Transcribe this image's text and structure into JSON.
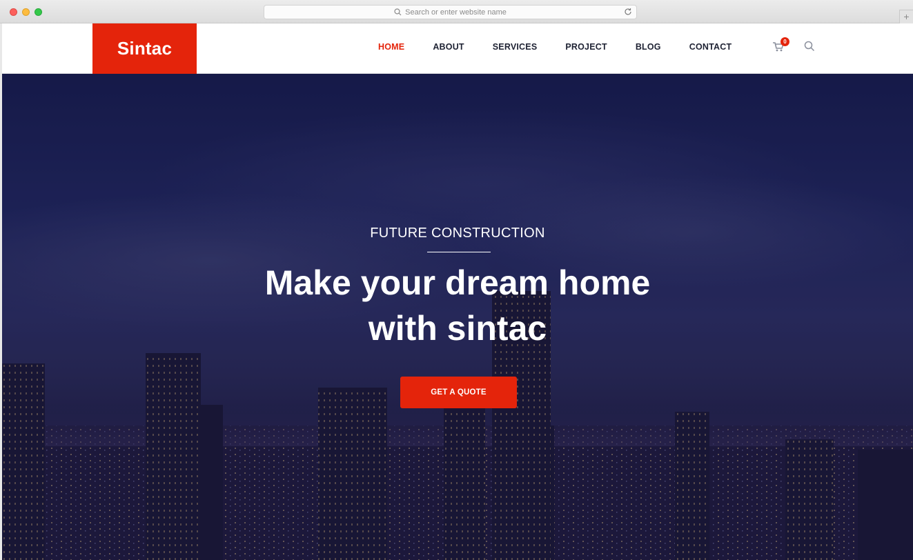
{
  "browser": {
    "url_placeholder": "Search or enter website name",
    "new_tab_label": "+"
  },
  "header": {
    "logo_text": "Sintac",
    "nav": [
      {
        "label": "HOME",
        "active": true
      },
      {
        "label": "ABOUT",
        "active": false
      },
      {
        "label": "SERVICES",
        "active": false
      },
      {
        "label": "PROJECT",
        "active": false
      },
      {
        "label": "BLOG",
        "active": false
      },
      {
        "label": "CONTACT",
        "active": false
      }
    ],
    "cart_count": "0"
  },
  "hero": {
    "eyebrow": "FUTURE CONSTRUCTION",
    "headline_line1": "Make your dream home",
    "headline_line2": "with sintac",
    "cta_label": "GET A QUOTE"
  },
  "colors": {
    "accent": "#e4240b",
    "nav_text": "#1e2233",
    "hero_overlay": "#1e2357"
  }
}
